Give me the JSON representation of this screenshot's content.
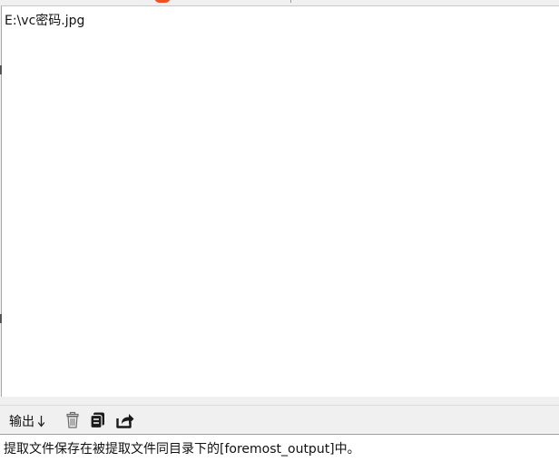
{
  "file_list": {
    "items": [
      "E:\\vc密码.jpg"
    ]
  },
  "toolbar": {
    "output_label": "输出",
    "arrow_icon": "arrow-down-icon",
    "icons": [
      "trash-icon",
      "copy-icon",
      "share-icon"
    ]
  },
  "status": {
    "message": "提取文件保存在被提取文件同目录下的[foremost_output]中。"
  },
  "colors": {
    "accent": "#f25022",
    "background": "#f0f0f0",
    "panel": "#ffffff"
  }
}
